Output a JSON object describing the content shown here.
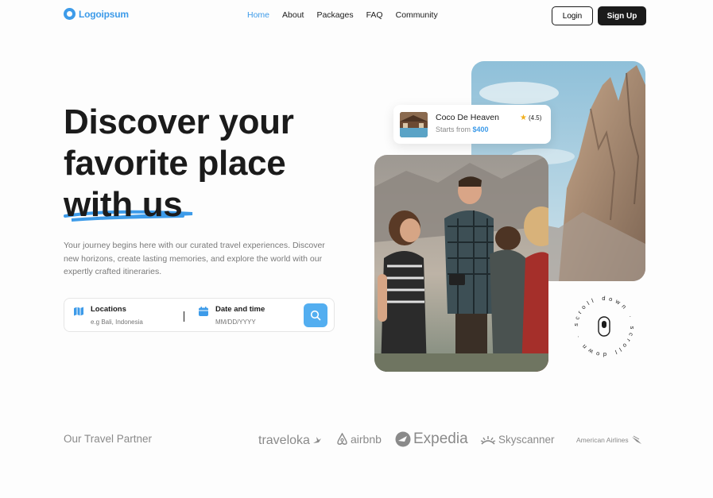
{
  "brand": {
    "name": "Logoipsum",
    "color": "#3d9be9"
  },
  "nav": {
    "items": [
      {
        "label": "Home",
        "active": true
      },
      {
        "label": "About",
        "active": false
      },
      {
        "label": "Packages",
        "active": false
      },
      {
        "label": "FAQ",
        "active": false
      },
      {
        "label": "Community",
        "active": false
      }
    ],
    "login_label": "Login",
    "signup_label": "Sign Up"
  },
  "hero": {
    "headline_line1": "Discover your",
    "headline_line2": "favorite place",
    "headline_line3": "with us",
    "description": "Your journey begins here with our curated travel experiences. Discover new horizons, create lasting memories, and explore the world with our expertly crafted itineraries."
  },
  "search": {
    "location_label": "Locations",
    "location_placeholder": "e.g Bali, Indonesia",
    "date_label": "Date and time",
    "date_placeholder": "MM/DD/YYYY",
    "search_icon": "search-icon"
  },
  "featured": {
    "title": "Coco De Heaven",
    "price_prefix": "Starts from ",
    "price": "$400",
    "rating": "(4.5)"
  },
  "scroll_badge": {
    "text": "scroll down · scroll down ·"
  },
  "partners": {
    "title": "Our Travel Partner",
    "items": [
      "traveloka",
      "airbnb",
      "Expedia",
      "Skyscanner",
      "American Airlines"
    ]
  },
  "colors": {
    "accent": "#3d9be9",
    "dark": "#1b1b1b",
    "muted": "#8a8a8a"
  }
}
